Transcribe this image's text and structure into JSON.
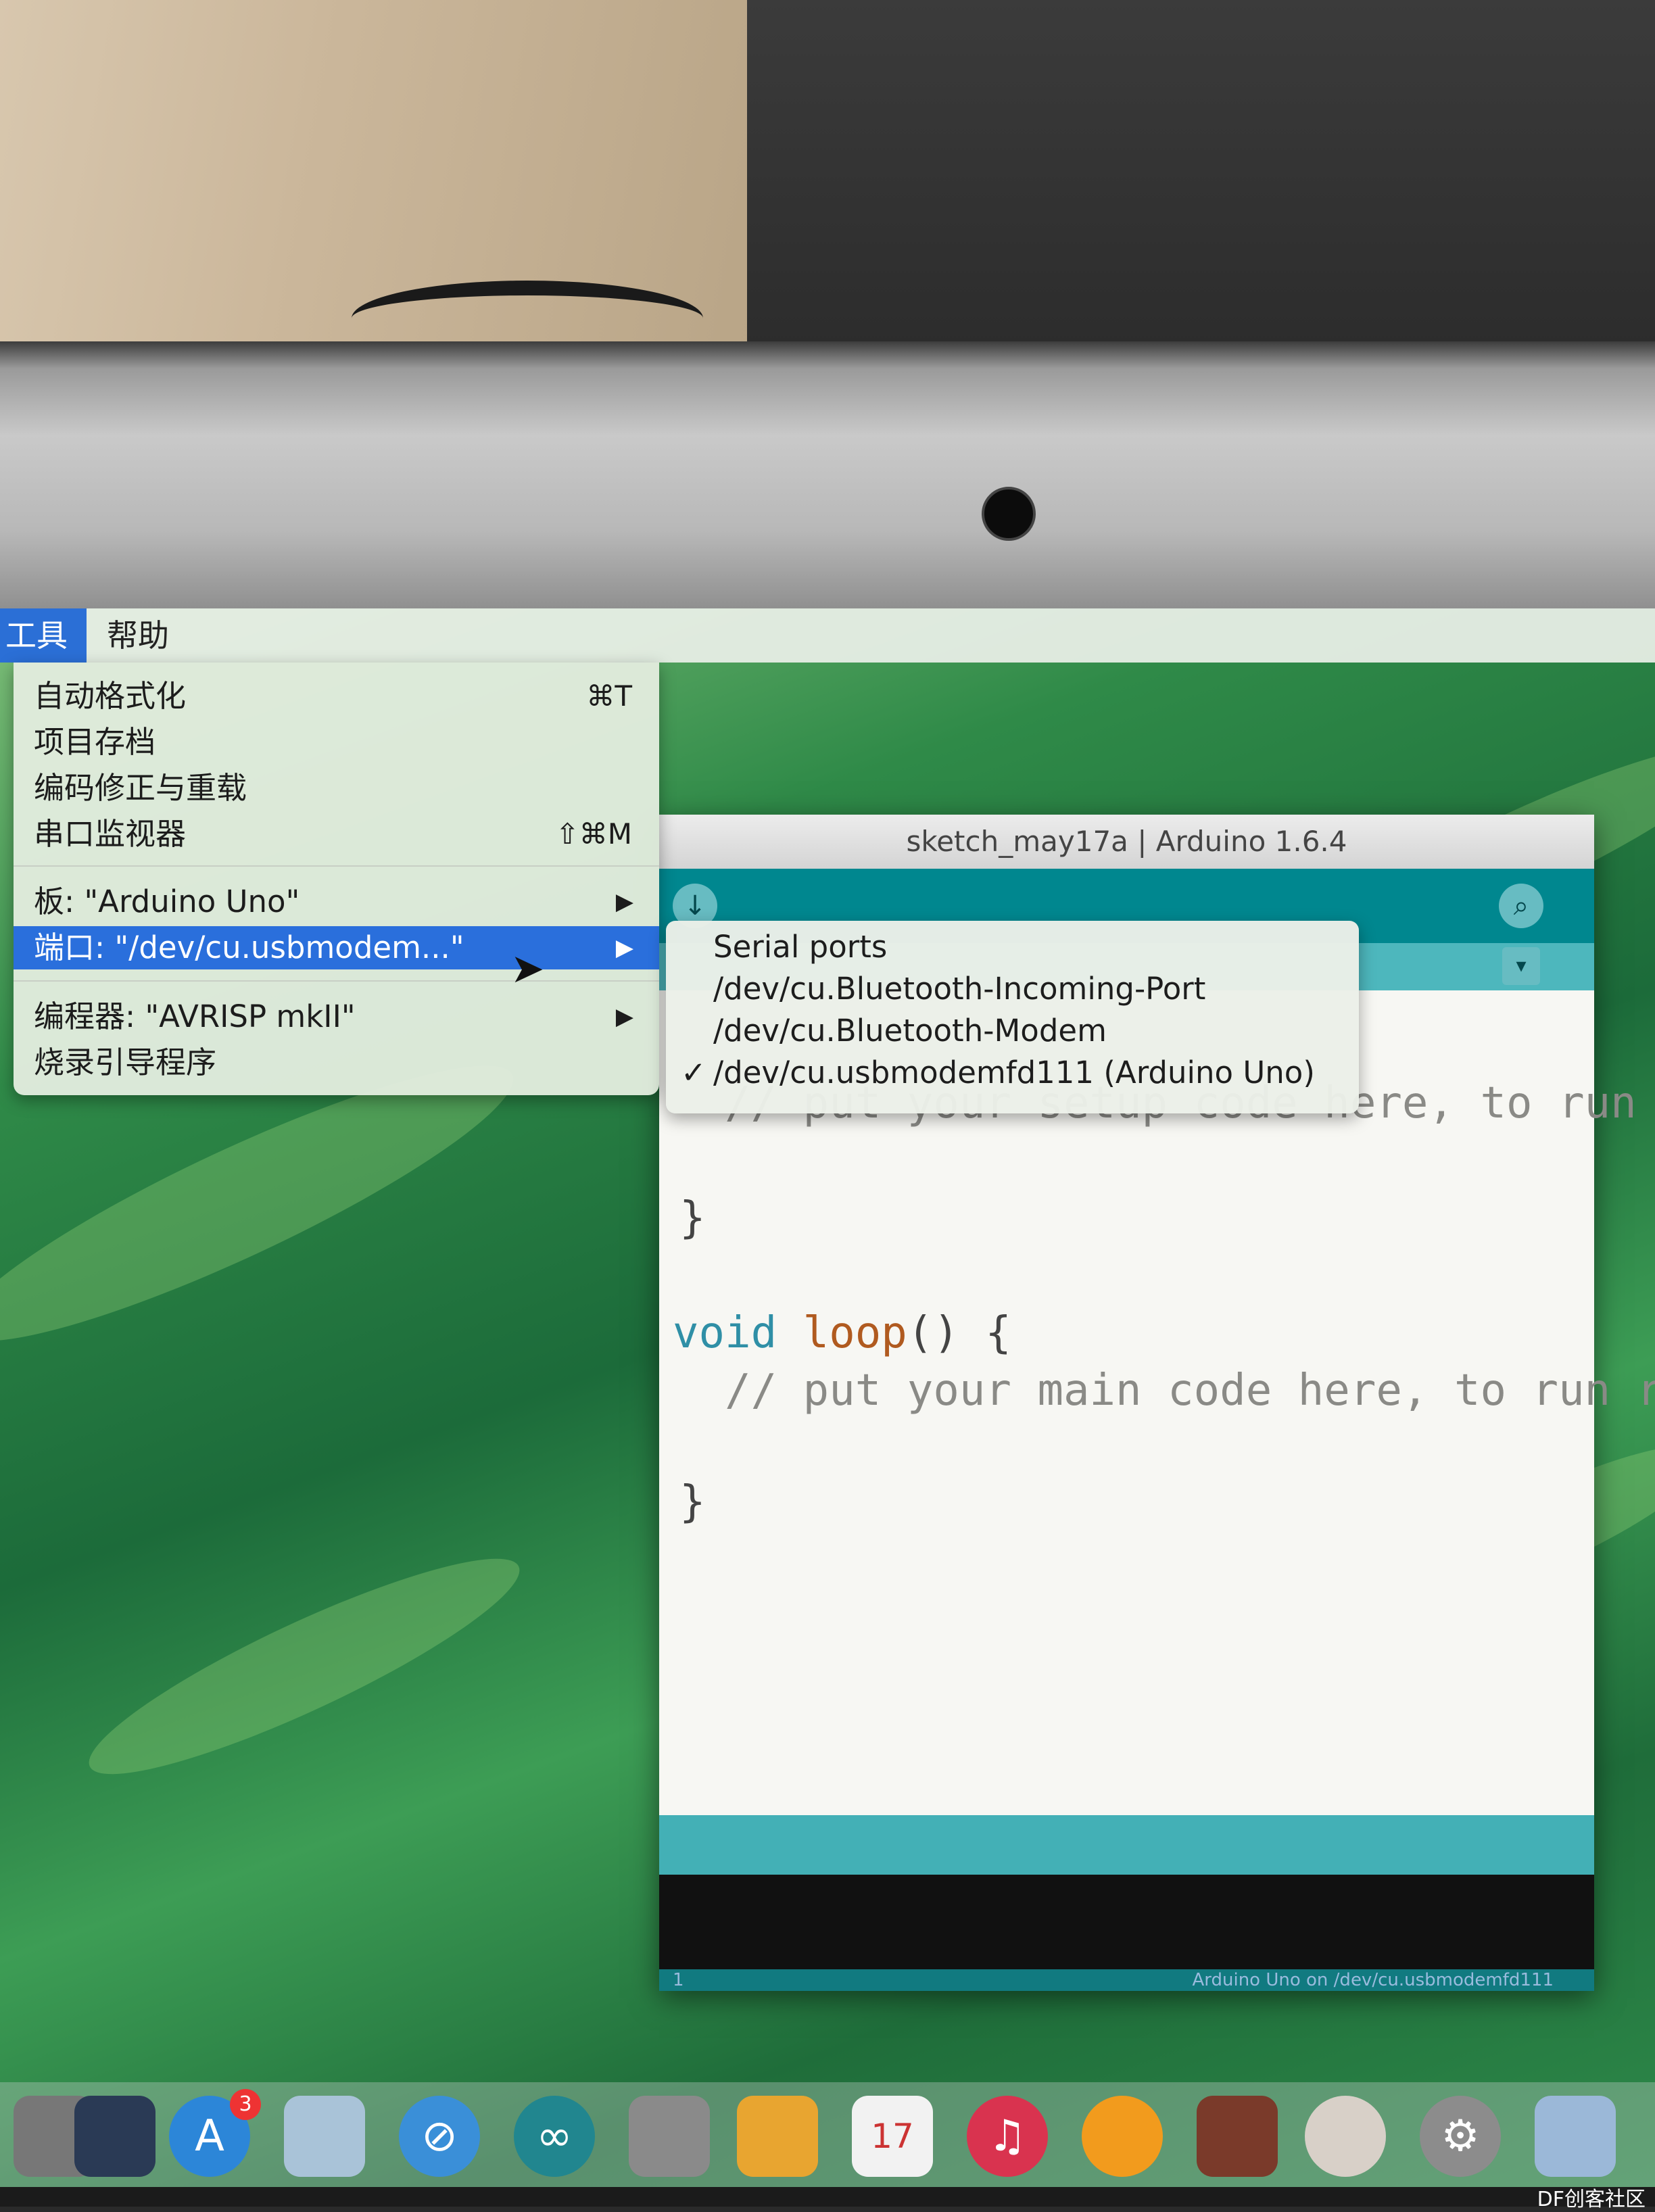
{
  "menubar": {
    "tools_label": "工具",
    "help_label": "帮助"
  },
  "tools_menu": {
    "items": [
      {
        "label": "自动格式化",
        "shortcut": "⌘T"
      },
      {
        "label": "项目存档",
        "shortcut": ""
      },
      {
        "label": "编码修正与重载",
        "shortcut": ""
      },
      {
        "label": "串口监视器",
        "shortcut": "⇧⌘M"
      },
      {
        "label": "板: \"Arduino Uno\"",
        "submenu": true
      },
      {
        "label": "端口: \"/dev/cu.usbmodem...\"",
        "submenu": true,
        "highlighted": true
      },
      {
        "label": "编程器: \"AVRISP mkII\"",
        "submenu": true
      },
      {
        "label": "烧录引导程序",
        "shortcut": ""
      }
    ],
    "submenu_arrow": "▶"
  },
  "port_submenu": {
    "header": "Serial ports",
    "items": [
      {
        "label": "/dev/cu.Bluetooth-Incoming-Port",
        "checked": false
      },
      {
        "label": "/dev/cu.Bluetooth-Modem",
        "checked": false
      },
      {
        "label": "/dev/cu.usbmodemfd111 (Arduino Uno)",
        "checked": true
      }
    ],
    "check_mark": "✓"
  },
  "arduino_window": {
    "title": "sketch_may17a | Arduino 1.6.4",
    "code_lines": [
      "  // put your setup code here, to run on",
      "}",
      "void loop() {",
      "  // put your main code here, to run rep",
      "}"
    ],
    "footer_line": "1",
    "footer_board": "Arduino Uno on /dev/cu.usbmodemfd111"
  },
  "dock": {
    "badge_count": "3",
    "calendar_day": "17"
  },
  "watermark": "DF创客社区",
  "colors": {
    "menu_highlight": "#2a6fdc",
    "arduino_teal": "#00878f",
    "arduino_status": "#43b0b6"
  }
}
